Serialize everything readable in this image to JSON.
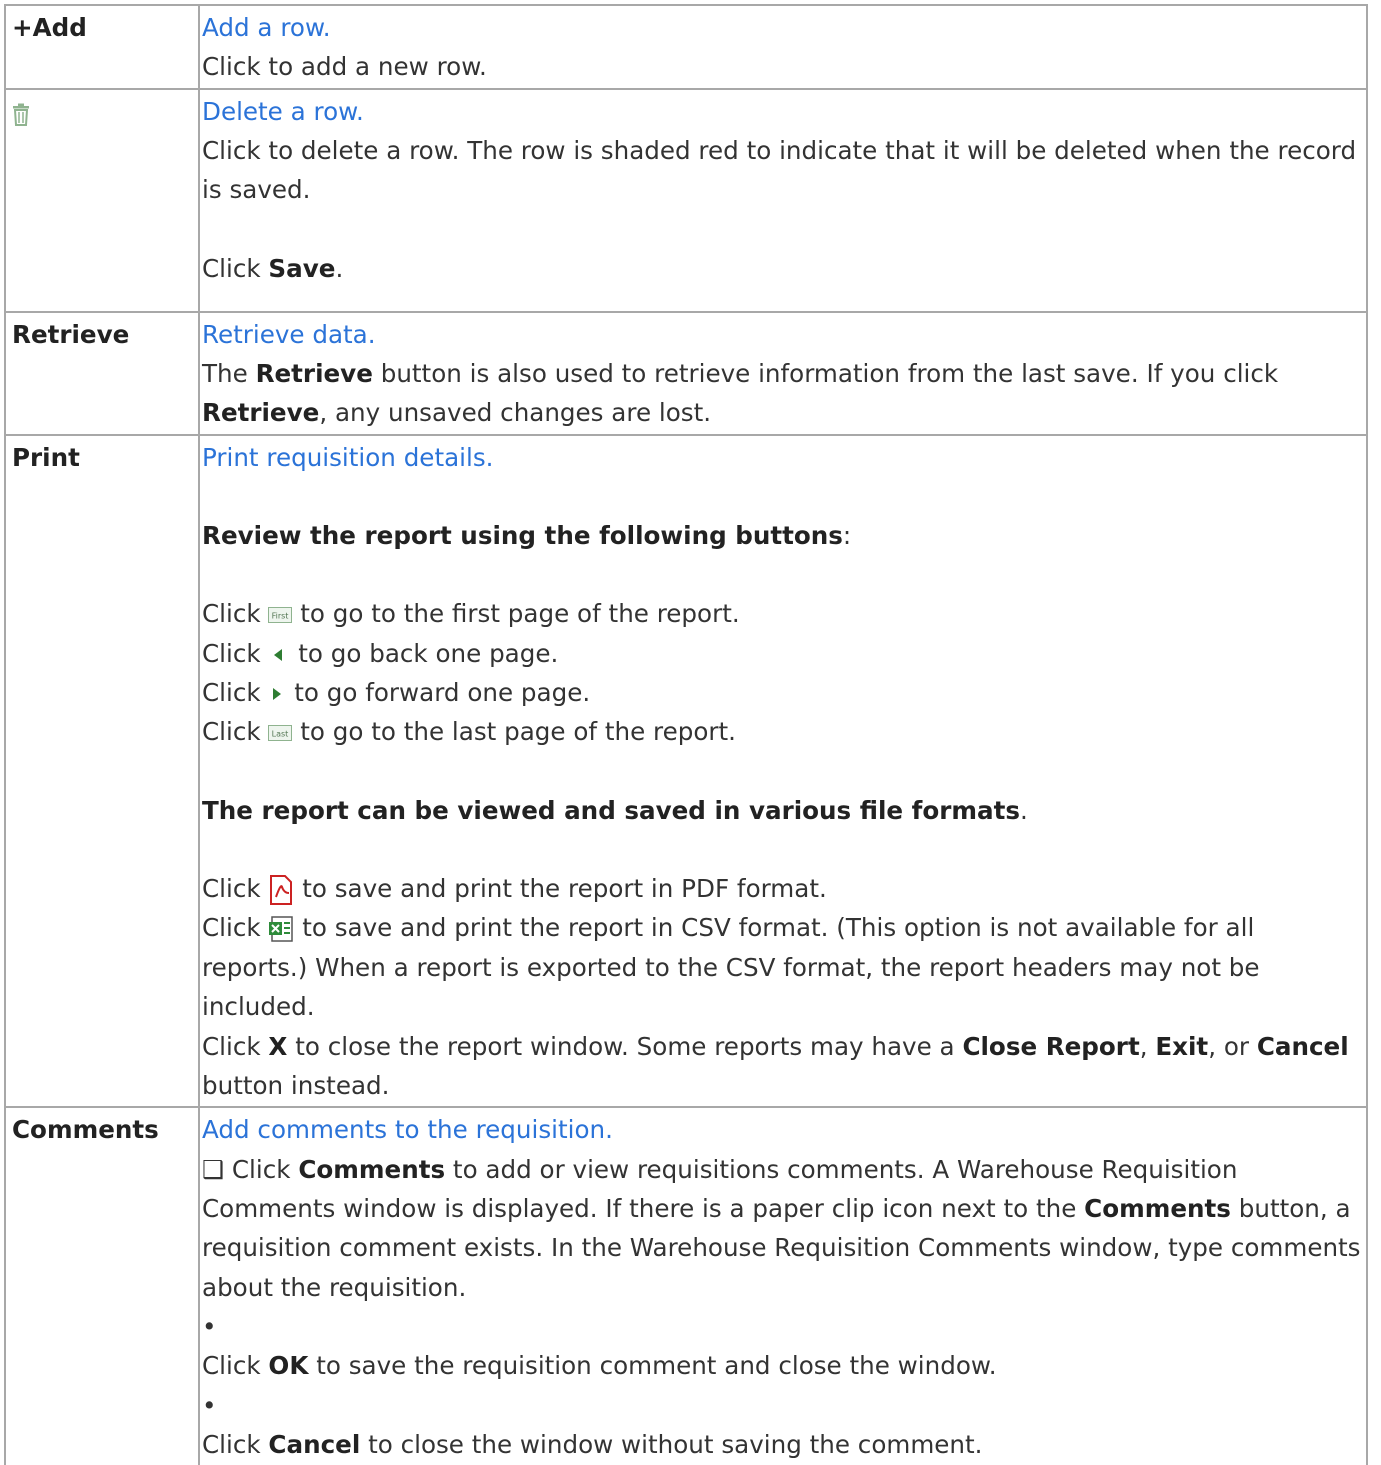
{
  "rows": [
    {
      "key": "+Add",
      "link": "Add a row.",
      "text": "Click to add a new row."
    },
    {
      "key_icon": "trash-icon",
      "link": "Delete a row.",
      "text": "Click to delete a row. The row is shaded red to indicate that it will be deleted when the record is saved.",
      "save_pre": "Click ",
      "save_bold": "Save",
      "save_post": "."
    },
    {
      "key": "Retrieve",
      "link": "Retrieve data.",
      "pre": "The ",
      "bold1": "Retrieve",
      "mid": " button is also used to retrieve information from the last save. If you click ",
      "bold2": "Retrieve",
      "post": ", any unsaved changes are lost."
    },
    {
      "key": "Print",
      "link": "Print requisition details.",
      "review_heading": "Review the report using the following buttons",
      "colon": ":",
      "nav": [
        {
          "icon": "first-page-icon",
          "pre": "Click ",
          "post": " to go to the first page of the report."
        },
        {
          "icon": "previous-page-icon",
          "pre": "Click ",
          "post": " to go back one page."
        },
        {
          "icon": "next-page-icon",
          "pre": "Click ",
          "post": " to go forward one page."
        },
        {
          "icon": "last-page-icon",
          "pre": "Click ",
          "post": " to go to the last page of the report."
        }
      ],
      "formats_heading": "The report can be viewed and saved in various file formats",
      "period": ".",
      "pdf": {
        "icon": "pdf-icon",
        "pre": "Click ",
        "post": " to save and print the report in PDF format."
      },
      "csv": {
        "icon": "excel-icon",
        "pre": "Click ",
        "post": " to save and print the report in CSV format. (This option is not available for all reports.) When a report is exported to the CSV format, the report headers may not be included."
      },
      "close": {
        "pre": "Click ",
        "x": "X",
        "mid": " to close the report window. Some reports may have a ",
        "b1": "Close Report",
        "s1": ", ",
        "b2": "Exit",
        "s2": ", or ",
        "b3": "Cancel",
        "post": " button instead."
      }
    },
    {
      "key": "Comments",
      "link": "Add comments to the requisition.",
      "box": "❑",
      "p1_pre": " Click ",
      "p1_b1": "Comments",
      "p1_mid": " to add or view requisitions comments. A Warehouse Requisition Comments window is displayed. If there is a paper clip icon next to the ",
      "p1_b2": "Comments",
      "p1_post": " button, a requisition comment exists. In the Warehouse Requisition Comments window, type comments about the requisition.",
      "bullet": "•",
      "ok_pre": "Click ",
      "ok_b": "OK",
      "ok_post": " to save the requisition comment and close the window.",
      "cancel_pre": "Click ",
      "cancel_b": "Cancel",
      "cancel_post": " to close the window without saving the comment."
    }
  ],
  "colors": {
    "link": "#2b73d8",
    "border": "#a8a8a8",
    "text": "#333333"
  }
}
